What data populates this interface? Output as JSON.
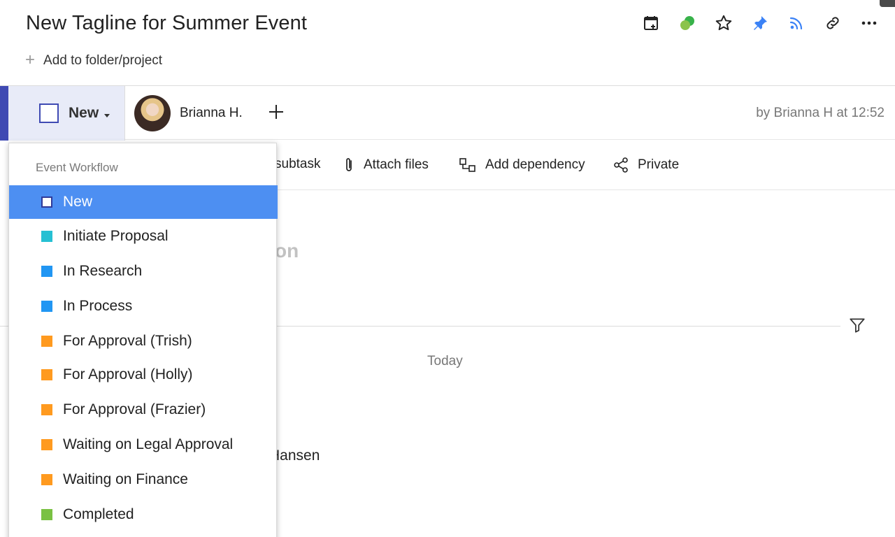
{
  "header": {
    "title": "New Tagline for Summer Event",
    "add_folder_label": "Add to folder/project"
  },
  "toolbar": {
    "icons": [
      "calendar-add-icon",
      "status-dots-icon",
      "star-icon",
      "pin-icon",
      "rss-icon",
      "link-icon",
      "more-icon"
    ]
  },
  "status": {
    "current": "New",
    "assignee_name": "Brianna H.",
    "created_by": "by Brianna H at 12:52"
  },
  "actions": {
    "subtask": "subtask",
    "attach": "Attach files",
    "dependency": "Add dependency",
    "private": "Private"
  },
  "body": {
    "description_partial": "on",
    "today": "Today",
    "activity_partial": "Hansen"
  },
  "dropdown": {
    "header": "Event Workflow",
    "items": [
      {
        "label": "New",
        "color": "#3f4ab3",
        "selected": true
      },
      {
        "label": "Initiate Proposal",
        "color": "#26c0d3"
      },
      {
        "label": "In Research",
        "color": "#2196f3"
      },
      {
        "label": "In Process",
        "color": "#2196f3"
      },
      {
        "label": "For Approval (Trish)",
        "color": "#ff9a1f"
      },
      {
        "label": "For Approval (Holly)",
        "color": "#ff9a1f"
      },
      {
        "label": "For Approval (Frazier)",
        "color": "#ff9a1f"
      },
      {
        "label": "Waiting on Legal Approval",
        "color": "#ff9a1f"
      },
      {
        "label": "Waiting on Finance",
        "color": "#ff9a1f"
      },
      {
        "label": "Completed",
        "color": "#7ac143"
      }
    ]
  },
  "colors": {
    "accent": "#3f4ab3",
    "selected_row": "#4d8ff2",
    "pin_blue": "#3b82f6",
    "green_dot": "#38b24a"
  }
}
